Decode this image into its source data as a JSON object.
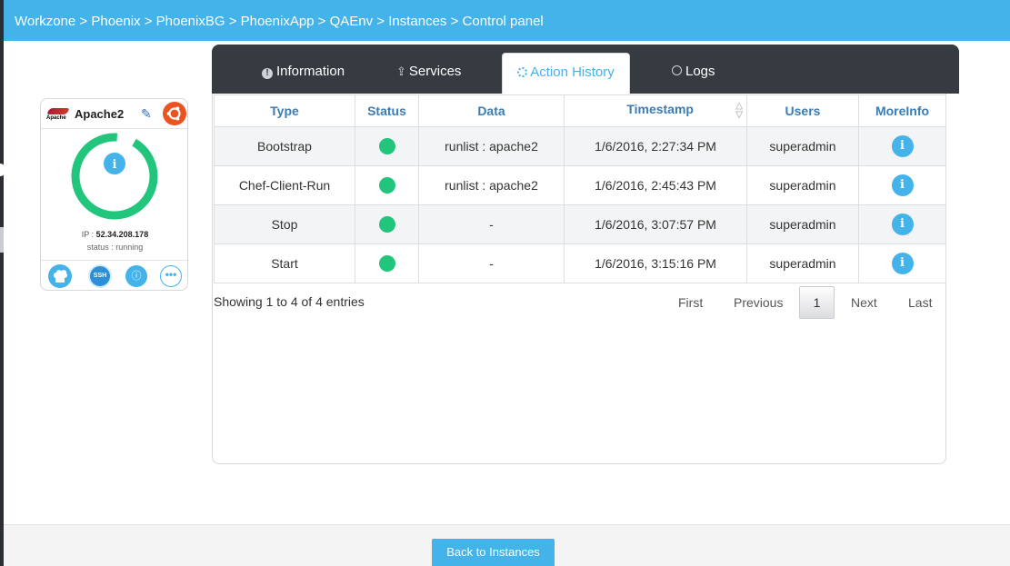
{
  "breadcrumb": "Workzone > Phoenix > PhoenixBG > PhoenixApp > QAEnv > Instances > Control panel",
  "instance": {
    "logo_text": "Apache",
    "name": "Apache2",
    "ip_label": "IP : ",
    "ip": "52.34.208.178",
    "status_text": "status : running",
    "ssh_label": "SSH",
    "more_label": "•••",
    "info_glyph": "i",
    "power_glyph": "ⓘ",
    "icons": [
      "apache-logo",
      "pencil-icon",
      "ubuntu-icon",
      "chef-icon",
      "ssh-icon",
      "info-icon",
      "more-icon"
    ]
  },
  "tabs": {
    "information": "Information",
    "services": "Services",
    "action_history": "Action History",
    "logs": "Logs"
  },
  "table": {
    "headers": [
      "Type",
      "Status",
      "Data",
      "Timestamp",
      "Users",
      "MoreInfo"
    ],
    "rows": [
      {
        "type": "Bootstrap",
        "status": "success",
        "data": "runlist : apache2",
        "timestamp": "1/6/2016, 2:27:34 PM",
        "user": "superadmin"
      },
      {
        "type": "Chef-Client-Run",
        "status": "success",
        "data": "runlist : apache2",
        "timestamp": "1/6/2016, 2:45:43 PM",
        "user": "superadmin"
      },
      {
        "type": "Stop",
        "status": "success",
        "data": "-",
        "timestamp": "1/6/2016, 3:07:57 PM",
        "user": "superadmin"
      },
      {
        "type": "Start",
        "status": "success",
        "data": "-",
        "timestamp": "1/6/2016, 3:15:16 PM",
        "user": "superadmin"
      }
    ],
    "info_glyph": "i"
  },
  "pagination": {
    "summary": "Showing 1 to 4 of 4 entries",
    "first": "First",
    "previous": "Previous",
    "current": "1",
    "next": "Next",
    "last": "Last"
  },
  "footer": {
    "back_button": "Back to Instances"
  },
  "colors": {
    "accent": "#43b3ea",
    "status_ok": "#21c57c",
    "tabbar": "#353b41",
    "ubuntu": "#e95420"
  }
}
